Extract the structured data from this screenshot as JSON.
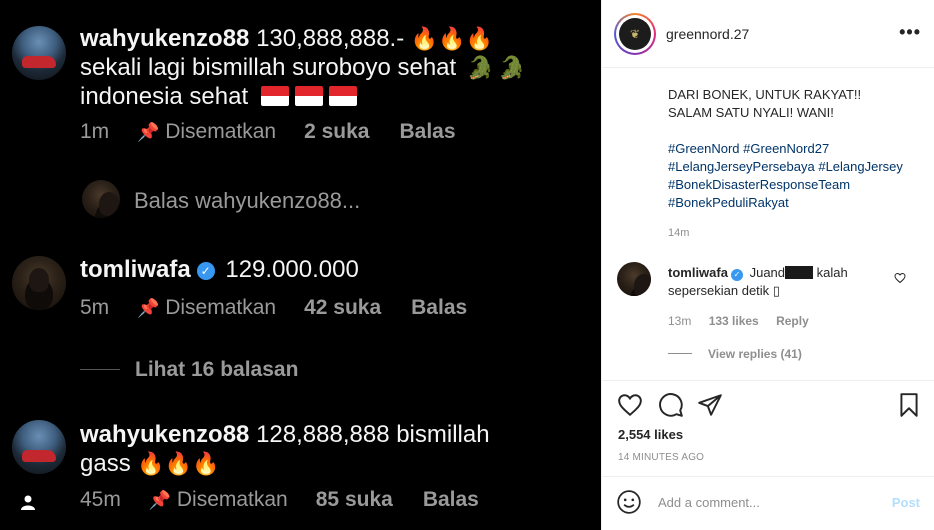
{
  "left": {
    "comments": [
      {
        "username": "wahyukenzo88",
        "text_line1": "130,888,888.-",
        "text_line2": "sekali lagi bismillah suroboyo sehat",
        "text_line3": "indonesia sehat",
        "time": "1m",
        "pinned": "Disematkan",
        "likes": "2 suka",
        "reply": "Balas"
      },
      {
        "username": "tomliwafa",
        "text": "129.000.000",
        "time": "5m",
        "pinned": "Disematkan",
        "likes": "42 suka",
        "reply": "Balas"
      },
      {
        "username": "wahyukenzo88",
        "text_line1": "128,888,888 bismillah",
        "text_line2": "gass",
        "time": "45m",
        "pinned": "Disematkan",
        "likes": "85 suka",
        "reply": "Balas"
      }
    ],
    "reply_prompt": "Balas wahyukenzo88...",
    "view_replies": "Lihat 16 balasan"
  },
  "right": {
    "header": {
      "username": "greennord.27",
      "more": "•••"
    },
    "caption": {
      "line1": "DARI BONEK, UNTUK RAKYAT!!",
      "line2": "SALAM SATU NYALI! WANI!",
      "hashtags": [
        "#GreenNord",
        "#GreenNord27",
        "#LelangJerseyPersebaya",
        "#LelangJersey",
        "#BonekDisasterResponseTeam",
        "#BonekPeduliRakyat"
      ],
      "time": "14m"
    },
    "comment": {
      "username": "tomliwafa",
      "text_a": "Juand",
      "text_b": "kalah",
      "text_c": "sepersekian detik",
      "emoji_box": "▯",
      "time": "13m",
      "likes": "133 likes",
      "reply": "Reply",
      "view_replies": "View replies (41)"
    },
    "likes": "2,554 likes",
    "posted_ago": "14 MINUTES AGO",
    "add_comment_placeholder": "Add a comment...",
    "post_button": "Post"
  },
  "icons": [
    "flame-icon",
    "crocodile-icon",
    "indonesia-flag-icon",
    "pin-icon",
    "verified-icon",
    "heart-icon",
    "comment-icon",
    "share-icon",
    "bookmark-icon",
    "smile-icon",
    "person-icon",
    "more-icon"
  ]
}
